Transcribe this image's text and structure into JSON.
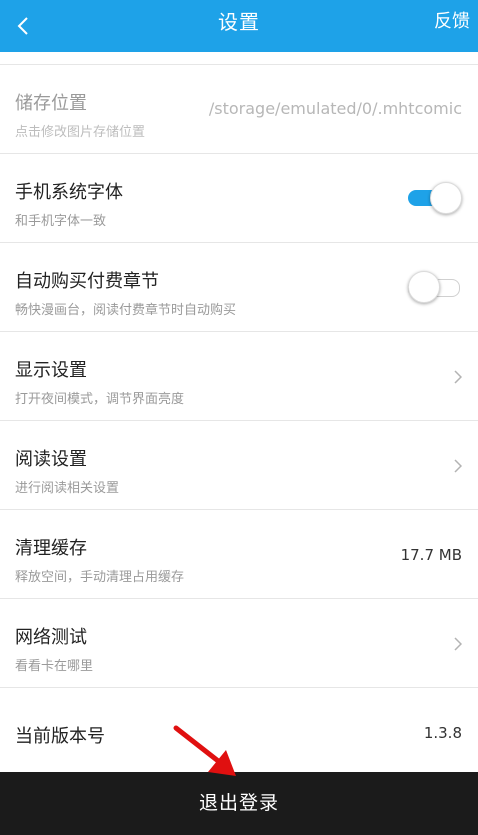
{
  "header": {
    "title": "设置",
    "feedback_label": "反馈"
  },
  "settings": [
    {
      "title": "储存位置",
      "subtitle": "点击修改图片存储位置",
      "value": "/storage/emulated/0/.mhtcomic"
    },
    {
      "title": "手机系统字体",
      "subtitle": "和手机字体一致",
      "toggle": "on"
    },
    {
      "title": "自动购买付费章节",
      "subtitle": "畅快漫画台，阅读付费章节时自动购买",
      "toggle": "off"
    },
    {
      "title": "显示设置",
      "subtitle": "打开夜间模式，调节界面亮度"
    },
    {
      "title": "阅读设置",
      "subtitle": "进行阅读相关设置"
    },
    {
      "title": "清理缓存",
      "subtitle": "释放空间，手动清理占用缓存",
      "value": "17.7 MB"
    },
    {
      "title": "网络测试",
      "subtitle": "看看卡在哪里"
    },
    {
      "title": "当前版本号",
      "value": "1.3.8"
    }
  ],
  "logout_label": "退出登录",
  "colors": {
    "accent": "#1ea2e8",
    "logout_bar": "#1b1b1b",
    "annotation_arrow": "#e01010"
  }
}
